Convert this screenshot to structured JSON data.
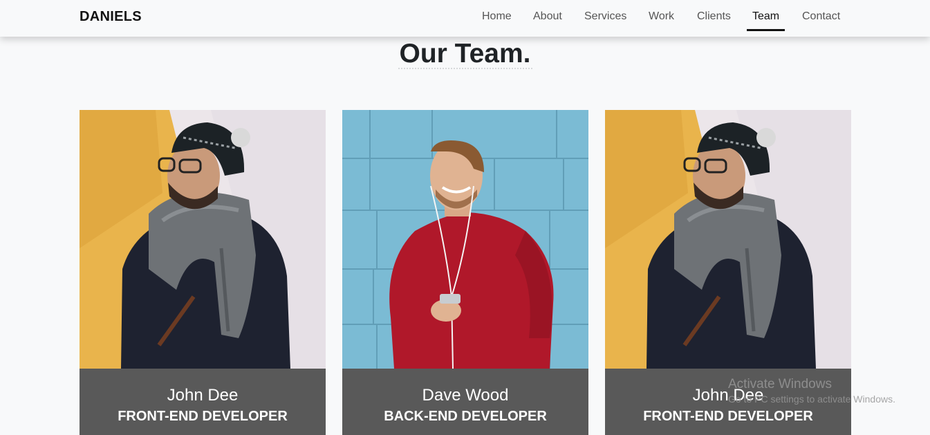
{
  "nav": {
    "brand": "DANIELS",
    "links": [
      "Home",
      "About",
      "Services",
      "Work",
      "Clients",
      "Team",
      "Contact"
    ],
    "active": "Team"
  },
  "section": {
    "title": "Our Team."
  },
  "team": [
    {
      "name": "John Dee",
      "role": "FRONT-END DEVELOPER"
    },
    {
      "name": "Dave Wood",
      "role": "BACK-END DEVELOPER"
    },
    {
      "name": "John Dee",
      "role": "FRONT-END DEVELOPER"
    }
  ],
  "watermark": {
    "title": "Activate Windows",
    "subtitle": "Go to PC settings to activate Windows."
  },
  "colors": {
    "background": "#f8f9fa",
    "caption_bg": "#595959",
    "nav_active": "#111111",
    "nav_text": "#555555"
  }
}
